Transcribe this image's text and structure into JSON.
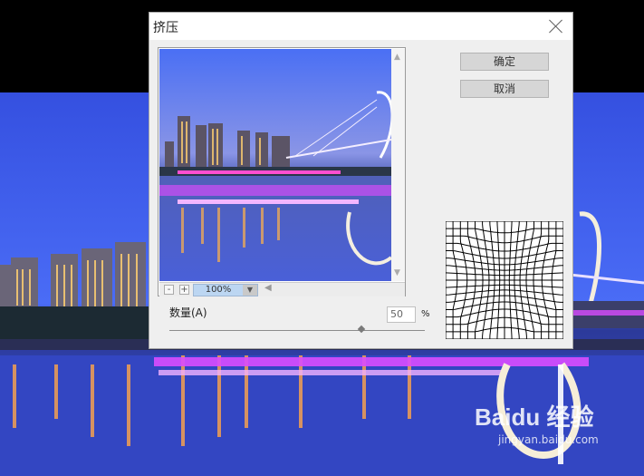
{
  "dialog": {
    "title": "挤压",
    "ok_label": "确定",
    "cancel_label": "取消",
    "zoom": {
      "value": "100%",
      "minus": "-",
      "plus": "+"
    },
    "amount": {
      "label": "数量(A)",
      "value": "50",
      "unit": "%",
      "level_percent": 75
    }
  },
  "watermark": {
    "text": "Baidu 经验",
    "url": "jingyan.baidu.com"
  },
  "colors": {
    "sky_top": "#3550e0",
    "sky_mid": "#4a6cf0",
    "city_lights": "#ffb24a",
    "bridge_pink": "#d94cff",
    "dialog_bg": "#efefef",
    "zoom_select": "#bcd6f2"
  }
}
